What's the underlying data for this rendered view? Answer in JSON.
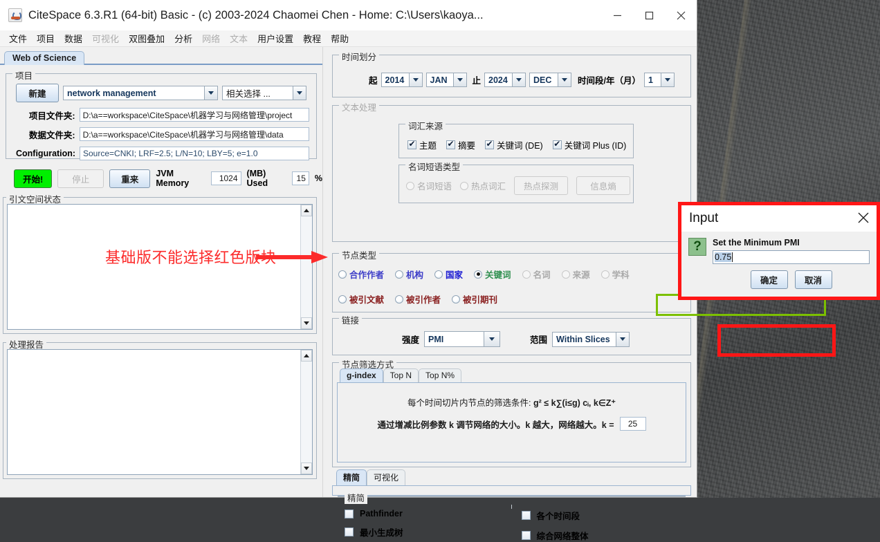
{
  "window": {
    "title": "CiteSpace 6.3.R1 (64-bit) Basic - (c) 2003-2024 Chaomei Chen - Home: C:\\Users\\kaoya...",
    "minimize_label": "minimize",
    "maximize_label": "maximize",
    "close_label": "close"
  },
  "menubar": {
    "items": [
      {
        "label": "文件",
        "enabled": true
      },
      {
        "label": "项目",
        "enabled": true
      },
      {
        "label": "数据",
        "enabled": true
      },
      {
        "label": "可视化",
        "enabled": false
      },
      {
        "label": "双图叠加",
        "enabled": true
      },
      {
        "label": "分析",
        "enabled": true
      },
      {
        "label": "网络",
        "enabled": false
      },
      {
        "label": "文本",
        "enabled": false
      },
      {
        "label": "用户设置",
        "enabled": true
      },
      {
        "label": "教程",
        "enabled": true
      },
      {
        "label": "帮助",
        "enabled": true
      }
    ]
  },
  "tabs": {
    "active": "Web of Science"
  },
  "project": {
    "group_title": "项目",
    "new_button": "新建",
    "project_combo_value": "network management",
    "related_combo_value": "相关选择 ...",
    "project_folder_label": "项目文件夹:",
    "project_folder_value": "D:\\a==workspace\\CiteSpace\\机器学习与网络管理\\project",
    "data_folder_label": "数据文件夹:",
    "data_folder_value": "D:\\a==workspace\\CiteSpace\\机器学习与网络管理\\data",
    "configuration_label": "Configuration:",
    "configuration_value": "Source=CNKI; LRF=2.5; L/N=10; LBY=5; e=1.0"
  },
  "run_bar": {
    "start_label": "开始!",
    "stop_label": "停止",
    "reset_label": "重来",
    "jvm_label": "JVM Memory",
    "jvm_value": "1024",
    "mb_used_label": "(MB) Used",
    "used_value": "15",
    "percent_label": "%"
  },
  "citation_status": {
    "group_title": "引文空间状态",
    "content": ""
  },
  "process_report": {
    "group_title": "处理报告",
    "content": ""
  },
  "annotation": {
    "text": "基础版不能选择红色版块",
    "color": "#fc2b2b"
  },
  "time_slicing": {
    "group_title": "时间划分",
    "from_label": "起",
    "from_year": "2014",
    "from_month": "JAN",
    "to_label": "止",
    "to_year": "2024",
    "to_month": "DEC",
    "slice_label": "时间段/年（月）",
    "slice_value": "1"
  },
  "text_processing": {
    "group_title": "文本处理",
    "term_source": {
      "group_title": "词汇来源",
      "options": [
        {
          "label": "主题",
          "checked": true
        },
        {
          "label": "摘要",
          "checked": true
        },
        {
          "label": "关键词 (DE)",
          "checked": true
        },
        {
          "label": "关键词 Plus (ID)",
          "checked": true
        }
      ]
    },
    "noun_phrase": {
      "group_title": "名词短语类型",
      "radios": [
        {
          "label": "名词短语",
          "selected": false,
          "enabled": false
        },
        {
          "label": "热点词汇",
          "selected": false,
          "enabled": false
        }
      ],
      "buttons": [
        {
          "label": "热点探测",
          "enabled": false
        },
        {
          "label": "信息熵",
          "enabled": false
        }
      ]
    }
  },
  "node_types": {
    "group_title": "节点类型",
    "row1": [
      {
        "label": "合作作者",
        "selected": false,
        "enabled": true,
        "color": "#3d3dc8"
      },
      {
        "label": "机构",
        "selected": false,
        "enabled": true,
        "color": "#3d3dc8"
      },
      {
        "label": "国家",
        "selected": false,
        "enabled": true,
        "color": "#1a1ad2"
      },
      {
        "label": "关键词",
        "selected": true,
        "enabled": true,
        "color": "#2f8f4f"
      },
      {
        "label": "名词",
        "selected": false,
        "enabled": false,
        "color": "#a9a9a9"
      },
      {
        "label": "来源",
        "selected": false,
        "enabled": false,
        "color": "#a9a9a9"
      },
      {
        "label": "学科",
        "selected": false,
        "enabled": false,
        "color": "#a9a9a9"
      }
    ],
    "row2": [
      {
        "label": "被引文献",
        "selected": false,
        "enabled": true,
        "color": "#8a2020"
      },
      {
        "label": "被引作者",
        "selected": false,
        "enabled": true,
        "color": "#8a2020"
      },
      {
        "label": "被引期刊",
        "selected": false,
        "enabled": true,
        "color": "#8a2020"
      }
    ],
    "row2_highlight_color": "#7cc000"
  },
  "links": {
    "group_title": "链接",
    "strength_label": "强度",
    "strength_value": "PMI",
    "scope_label": "范围",
    "scope_value": "Within Slices",
    "highlight_color": "#ff1616"
  },
  "node_selection": {
    "group_title": "节点筛选方式",
    "tabs": [
      {
        "label": "g-index",
        "active": true
      },
      {
        "label": "Top N",
        "active": false
      },
      {
        "label": "Top N%",
        "active": false
      }
    ],
    "formula_line1_prefix": "每个时间切片内节点的筛选条件: ",
    "formula_line1_math": "g² ≤ k∑(i≤g) cᵢ, k∈Z⁺",
    "formula_line2": "通过增减比例参数 k 调节网络的大小。k 越大，网络越大。k = ",
    "k_value": "25"
  },
  "bottom_panel": {
    "tabs": [
      {
        "label": "精简",
        "active": true
      },
      {
        "label": "可视化",
        "active": false
      }
    ],
    "group_title": "精简",
    "left_options": [
      {
        "label": "Pathfinder",
        "checked": false
      },
      {
        "label": "最小生成树",
        "checked": false
      }
    ],
    "right_options": [
      {
        "label": "各个时间段",
        "checked": false
      },
      {
        "label": "综合网络整体",
        "checked": false
      }
    ]
  },
  "dialog": {
    "title": "Input",
    "icon": "question-mark-icon",
    "label": "Set the Minimum PMI",
    "value": "0.75",
    "ok_label": "确定",
    "cancel_label": "取消",
    "border_color": "#ff1616"
  }
}
